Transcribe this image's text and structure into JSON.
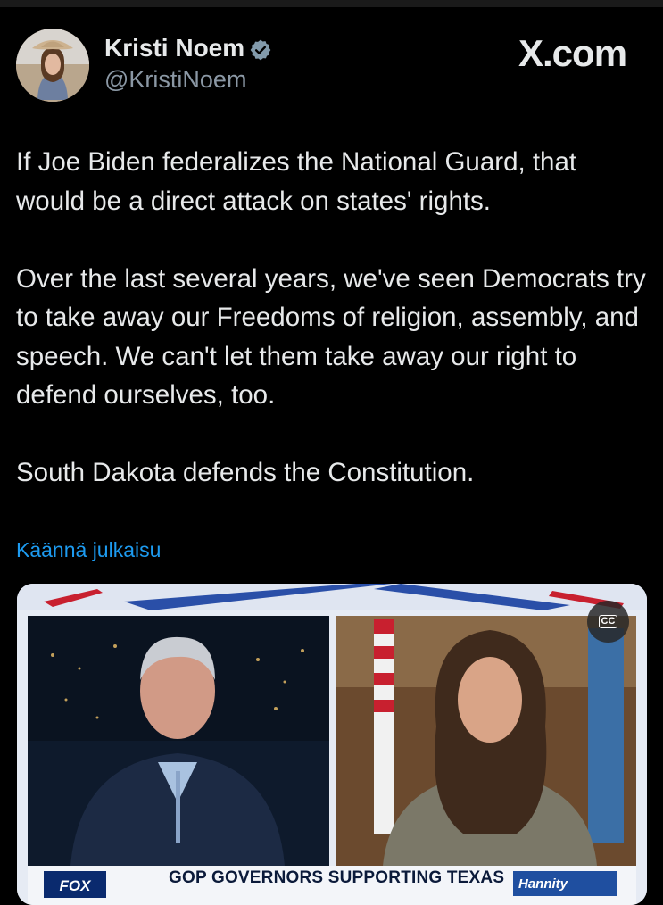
{
  "author": {
    "name": "Kristi Noem",
    "handle": "@KristiNoem",
    "verified_icon": "verified-badge-icon"
  },
  "brand": {
    "label": "X.com"
  },
  "post": {
    "paragraphs": [
      "If Joe Biden federalizes the National Guard, that would be a direct attack on states' rights.",
      "Over the last several years, we've seen Democrats try to take away our Freedoms of religion, assembly, and speech. We can't let them take away our right to defend ourselves, too.",
      "South Dakota defends the Constitution."
    ],
    "translate_label": "Käännä julkaisu"
  },
  "media": {
    "cc_label": "CC",
    "fox_logo": "FOX",
    "banner": "GOP GOVERNORS SUPPORTING TEXAS",
    "show_logo": "Hannity"
  },
  "colors": {
    "background": "#000000",
    "text": "#e7e9ea",
    "secondary": "#8b98a5",
    "link": "#1d9bf0",
    "verified": "#829aab"
  }
}
